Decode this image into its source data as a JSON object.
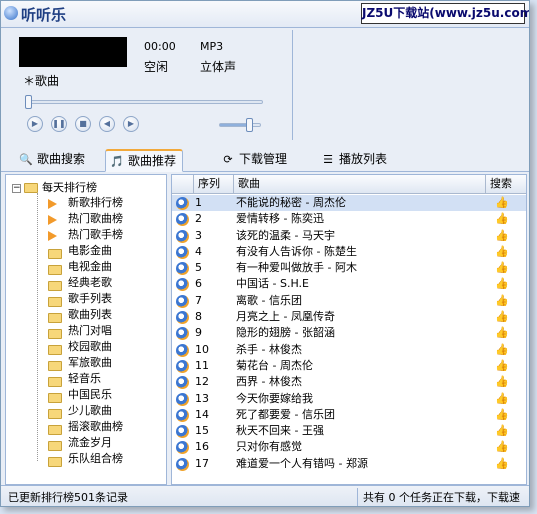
{
  "app": {
    "title": "听听乐",
    "watermark": "JZ5U下载站(www.jz5u.com)"
  },
  "player": {
    "time": "00:00",
    "format": "MP3",
    "status": "空闲",
    "channel": "立体声",
    "song_label": "＊歌曲",
    "progress": 0.0,
    "volume": 0.75
  },
  "tabs": [
    {
      "label": "歌曲搜索",
      "icon": "search-icon",
      "active": false
    },
    {
      "label": "歌曲推荐",
      "icon": "recommend-icon",
      "active": true
    },
    {
      "label": "下载管理",
      "icon": "download-icon",
      "active": false
    },
    {
      "label": "播放列表",
      "icon": "playlist-icon",
      "active": false
    }
  ],
  "tree": {
    "root": "每天排行榜",
    "items": [
      {
        "label": "新歌排行榜",
        "icon": "arrow-icon"
      },
      {
        "label": "热门歌曲榜",
        "icon": "arrow-icon"
      },
      {
        "label": "热门歌手榜",
        "icon": "arrow-icon"
      },
      {
        "label": "电影金曲",
        "icon": "folder-icon"
      },
      {
        "label": "电视金曲",
        "icon": "folder-icon"
      },
      {
        "label": "经典老歌",
        "icon": "folder-icon"
      },
      {
        "label": "歌手列表",
        "icon": "folder-icon"
      },
      {
        "label": "歌曲列表",
        "icon": "folder-icon"
      },
      {
        "label": "热门对唱",
        "icon": "folder-icon"
      },
      {
        "label": "校园歌曲",
        "icon": "folder-icon"
      },
      {
        "label": "军旅歌曲",
        "icon": "folder-icon"
      },
      {
        "label": "轻音乐",
        "icon": "folder-icon"
      },
      {
        "label": "中国民乐",
        "icon": "folder-icon"
      },
      {
        "label": "少儿歌曲",
        "icon": "folder-icon"
      },
      {
        "label": "摇滚歌曲榜",
        "icon": "folder-icon"
      },
      {
        "label": "流金岁月",
        "icon": "folder-icon"
      },
      {
        "label": "乐队组合榜",
        "icon": "folder-icon"
      }
    ]
  },
  "list": {
    "columns": [
      "序列",
      "歌曲",
      "搜索"
    ],
    "rows": [
      {
        "num": "1",
        "song": "不能说的秘密 - 周杰伦"
      },
      {
        "num": "2",
        "song": "爱情转移 - 陈奕迅"
      },
      {
        "num": "3",
        "song": "该死的温柔 - 马天宇"
      },
      {
        "num": "4",
        "song": "有没有人告诉你 - 陈楚生"
      },
      {
        "num": "5",
        "song": "有一种爱叫做放手 - 阿木"
      },
      {
        "num": "6",
        "song": "中国话 - S.H.E"
      },
      {
        "num": "7",
        "song": "离歌 - 信乐团"
      },
      {
        "num": "8",
        "song": "月亮之上 - 凤凰传奇"
      },
      {
        "num": "9",
        "song": "隐形的翅膀 - 张韶涵"
      },
      {
        "num": "10",
        "song": "杀手 - 林俊杰"
      },
      {
        "num": "11",
        "song": "菊花台 - 周杰伦"
      },
      {
        "num": "12",
        "song": "西界 - 林俊杰"
      },
      {
        "num": "13",
        "song": "今天你要嫁给我"
      },
      {
        "num": "14",
        "song": "死了都要爱 - 信乐团"
      },
      {
        "num": "15",
        "song": "秋天不回来 - 王强"
      },
      {
        "num": "16",
        "song": "只对你有感觉"
      },
      {
        "num": "17",
        "song": "难道爱一个人有错吗 - 郑源"
      }
    ]
  },
  "statusbar": {
    "left": "已更新排行榜501条记录",
    "right": "共有 0 个任务正在下载，下载速"
  }
}
